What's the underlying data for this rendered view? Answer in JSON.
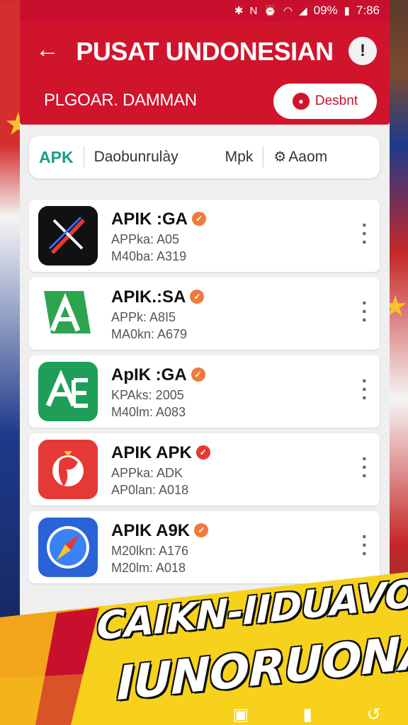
{
  "status_bar": {
    "icons": [
      "bluetooth-icon",
      "nfc-icon",
      "alarm-icon",
      "wifi-icon",
      "signal-icon",
      "battery-icon"
    ],
    "battery": "09%",
    "time": "7:86"
  },
  "header": {
    "title": "PUSAT UNDONESIAN",
    "subtitle": "PLGOAR. DAMMAN",
    "info_label": "!",
    "download_label": "Desbnt",
    "color": "#d0142c"
  },
  "tabs": [
    {
      "label": "APK",
      "active": true
    },
    {
      "label": "Daobunrulày"
    },
    {
      "label": "Mpk"
    },
    {
      "label": "Aaom",
      "icon": "gear-icon"
    }
  ],
  "apps": [
    {
      "name": "APIK :GA",
      "line1": "APPka: A05",
      "line2": "M40ba: A319",
      "badge": "orange",
      "icon": "compass-black-icon"
    },
    {
      "name": "APIK.:SA",
      "line1": "APPk: A8I5",
      "line2": "MA0kn: A679",
      "badge": "orange",
      "icon": "green-a-icon"
    },
    {
      "name": "ApIK :GA",
      "line1": "KPAks: 2005",
      "line2": "M40lm: A083",
      "badge": "orange",
      "icon": "green-ae-icon"
    },
    {
      "name": "APIK APK",
      "line1": "APPka: ADK",
      "line2": "AP0lan: A018",
      "badge": "red",
      "icon": "red-bird-icon"
    },
    {
      "name": "APIK A9K",
      "line1": "M20lkn: A176",
      "line2": "M20lm: A018",
      "badge": "orange",
      "icon": "safari-compass-icon"
    }
  ],
  "banner": {
    "line1": "CAIKN-IIDUAVOS",
    "line2": "IUNORUONA",
    "colors": {
      "yellow": "#f7d21c",
      "red": "#c8102e"
    }
  },
  "nav": {
    "icons": [
      "gallery-icon",
      "home-icon",
      "back-icon"
    ]
  }
}
